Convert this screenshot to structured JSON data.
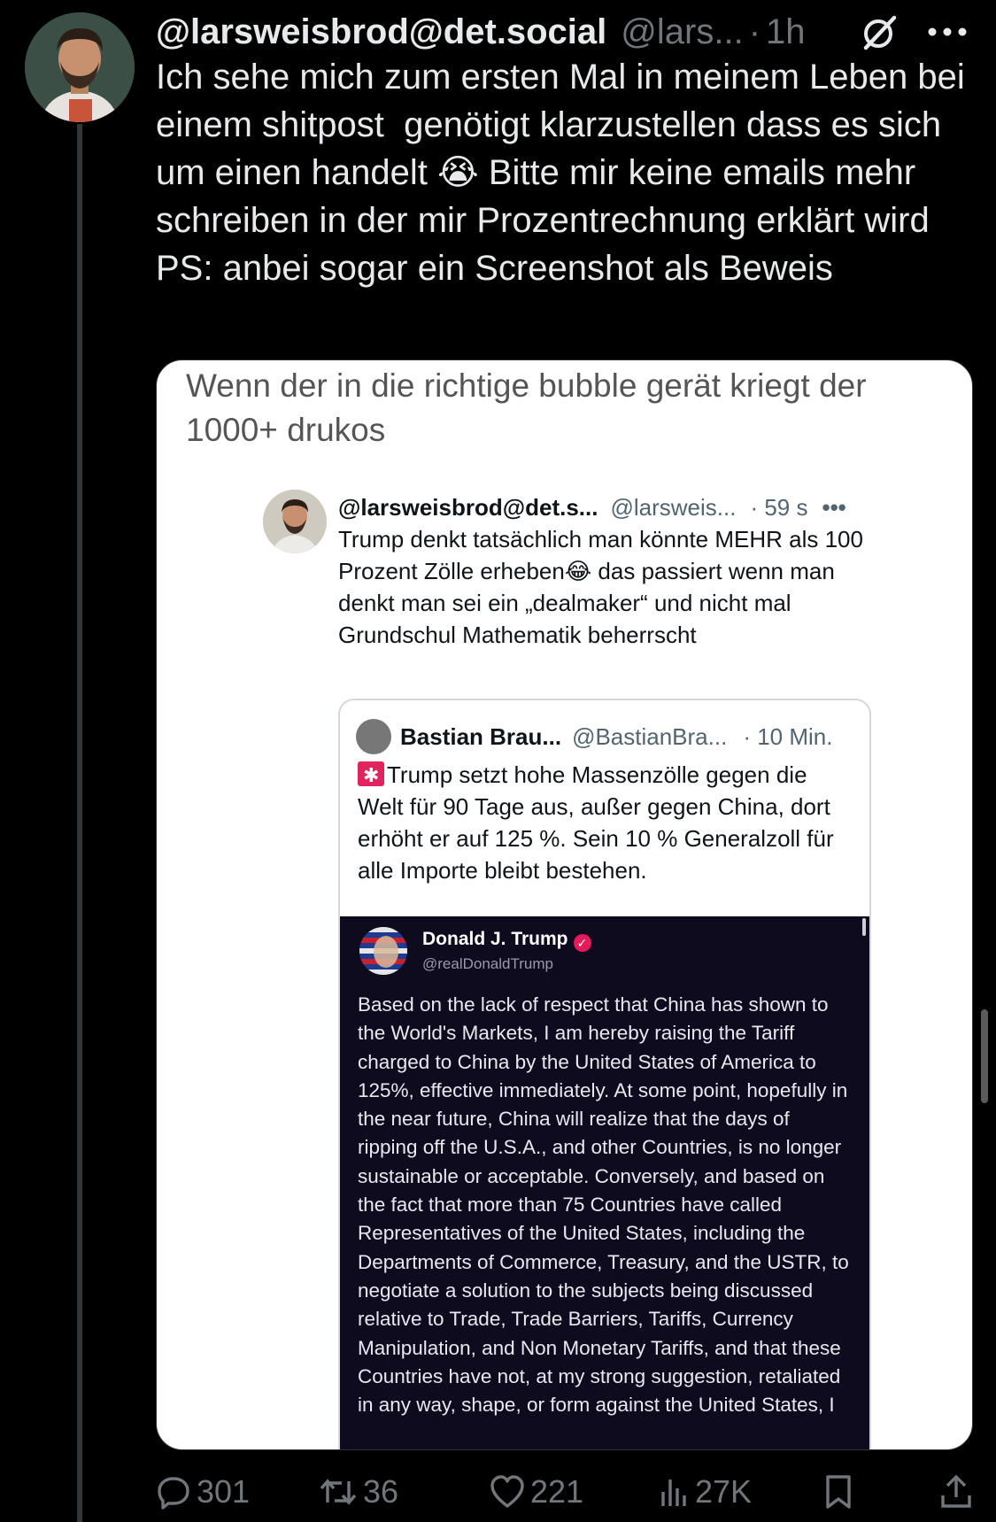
{
  "post": {
    "display_name": "@larsweisbrod@det.social",
    "handle": "@lars...",
    "separator": "·",
    "time": "1h",
    "text": "Ich sehe mich zum ersten Mal in meinem Leben bei einem shitpost  genötigt klarzustellen dass es sich um einen handelt 😭 Bitte mir keine emails mehr schreiben in der mir Prozentrechnung erklärt wird PS: anbei sogar ein Screenshot als Beweis"
  },
  "media": {
    "caption": "Wenn der in die richtige bubble gerät kriegt der 1000+ drukos",
    "inner_post": {
      "display_name": "@larsweisbrod@det.s...",
      "handle": "@larsweis...",
      "time": "· 59 s",
      "more": "•••",
      "text": "Trump denkt tatsächlich man könnte MEHR als 100 Prozent Zölle erheben😂 das passiert wenn man denkt man sei ein „dealmaker“ und nicht mal Grundschul Mathematik beherrscht"
    },
    "quote": {
      "display_name": "Bastian Brau...",
      "handle": "@BastianBra...",
      "time": "· 10 Min.",
      "text": "Trump setzt hohe Massenzölle gegen die Welt für 90 Tage aus, außer gegen China, dort erhöht er auf 125 %. Sein 10 % Generalzoll für alle Importe bleibt bestehen."
    },
    "truth_post": {
      "display_name": "Donald J. Trump",
      "handle": "@realDonaldTrump",
      "text": "Based on the lack of respect that China has shown to the World's Markets, I am hereby raising the Tariff charged to China by the United States of America to 125%, effective immediately. At some point, hopefully in the near future, China will realize that the days of ripping off the U.S.A., and other Countries, is no longer sustainable or acceptable. Conversely, and based on the fact that more than 75 Countries have called Representatives of the United States, including the Departments of Commerce, Treasury, and the USTR, to negotiate a solution to the subjects being discussed relative to Trade, Trade Barriers, Tariffs, Currency Manipulation, and Non Monetary Tariffs, and that these Countries have not, at my strong suggestion, retaliated in any way, shape, or form against the United States, I"
    }
  },
  "actions": {
    "replies": "301",
    "reposts": "36",
    "likes": "221",
    "views": "27K"
  },
  "icons": {
    "header": [
      "grok-icon",
      "more-icon"
    ],
    "actions": [
      "reply-icon",
      "repost-icon",
      "like-icon",
      "views-icon",
      "bookmark-icon",
      "share-icon"
    ]
  },
  "colors": {
    "background": "#000000",
    "text": "#e7e9ea",
    "muted": "#71767b",
    "truth_background": "#0e0b1f"
  }
}
